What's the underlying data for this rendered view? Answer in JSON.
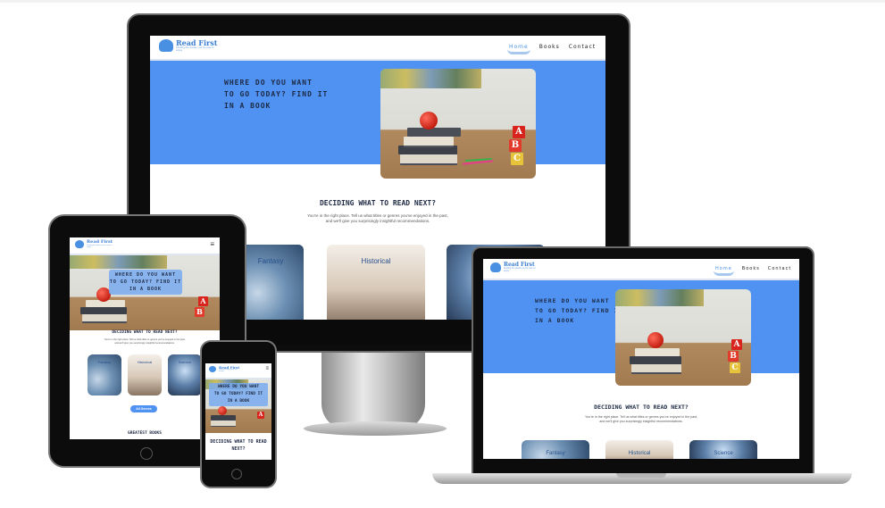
{
  "site": {
    "logo_title": "Read First",
    "logo_tagline": "Finding the books you're sure to enjoy",
    "nav": {
      "home": "Home",
      "books": "Books",
      "contact": "Contact"
    },
    "hero_heading": "WHERE DO YOU WANT TO GO TODAY? FIND IT IN A BOOK",
    "hero_line1": "WHERE DO YOU WANT",
    "hero_line2": "TO GO TODAY? FIND IT",
    "hero_line3": "IN A BOOK",
    "section_title": "DECIDING WHAT TO READ NEXT?",
    "section_text_line1": "You're in the right place. Tell us what titles or genres you've enjoyed in the past,",
    "section_text_line2": "and we'll give you surprisingly insightful recommendations.",
    "genres": {
      "fantasy": "Fantasy",
      "historical": "Historical",
      "science": "Science"
    },
    "all_genres_button": "All Genres",
    "greatest_books": "GREATEST BOOKS",
    "hamburger_icon": "≡",
    "block_a": "A",
    "block_b": "B",
    "block_c": "C"
  },
  "colors": {
    "hero_blue": "#4f92f2",
    "brand_blue": "#3b7fd4",
    "heading_navy": "#1e2a44"
  }
}
